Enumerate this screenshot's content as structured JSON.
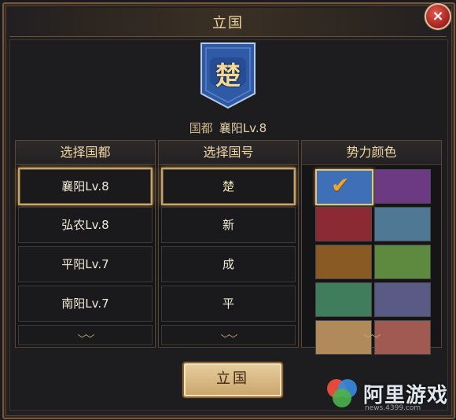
{
  "dialog": {
    "title": "立国",
    "close_label": "×"
  },
  "emblem": {
    "char": "楚"
  },
  "capital": {
    "label": "国都",
    "value": "襄阳Lv.8"
  },
  "columns": {
    "capital": {
      "header": "选择国都",
      "items": [
        "襄阳Lv.8",
        "弘农Lv.8",
        "平阳Lv.7",
        "南阳Lv.7"
      ],
      "selected_index": 0
    },
    "name": {
      "header": "选择国号",
      "items": [
        "楚",
        "新",
        "成",
        "平"
      ],
      "selected_index": 0
    },
    "color": {
      "header": "势力颜色",
      "swatches": [
        "#3f6fb6",
        "#6b3a82",
        "#8c2a33",
        "#4e7894",
        "#8a5a24",
        "#5d8a3e",
        "#3f7d5c",
        "#5a5a86",
        "#b08a5a",
        "#a05a52"
      ],
      "selected_index": 0
    }
  },
  "action": {
    "confirm_label": "立国"
  },
  "watermark": {
    "text": "阿里游戏",
    "sub": "news.4399.com"
  }
}
